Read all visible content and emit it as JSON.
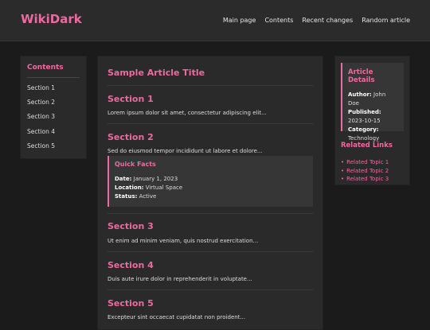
{
  "site": {
    "logo": "WikiDark"
  },
  "nav": [
    "Main page",
    "Contents",
    "Recent changes",
    "Random article"
  ],
  "contents": {
    "heading": "Contents",
    "items": [
      "Section 1",
      "Section 2",
      "Section 3",
      "Section 4",
      "Section 5"
    ]
  },
  "article": {
    "title": "Sample Article Title",
    "sections": [
      {
        "heading": "Section 1",
        "text": "Lorem ipsum dolor sit amet, consectetur adipiscing elit..."
      },
      {
        "heading": "Section 2",
        "text": "Sed do eiusmod tempor incididunt ut labore et dolore..."
      },
      {
        "heading": "Section 3",
        "text": "Ut enim ad minim veniam, quis nostrud exercitation..."
      },
      {
        "heading": "Section 4",
        "text": "Duis aute irure dolor in reprehenderit in voluptate..."
      },
      {
        "heading": "Section 5",
        "text": "Excepteur sint occaecat cupidatat non proident..."
      }
    ],
    "quick_facts": {
      "heading": "Quick Facts",
      "date_label": "Date:",
      "date": "January 1, 2023",
      "location_label": "Location:",
      "location": "Virtual Space",
      "status_label": "Status:",
      "status": "Active"
    }
  },
  "details": {
    "heading": "Article Details",
    "author_label": "Author:",
    "author": "John Doe",
    "published_label": "Published:",
    "published": "2023-10-15",
    "category_label": "Category:",
    "category": "Technology"
  },
  "related": {
    "heading": "Related Links",
    "items": [
      "Related Topic 1",
      "Related Topic 2",
      "Related Topic 3"
    ]
  },
  "colors": {
    "accent": "#ec6aa0",
    "background": "#1b1b1b",
    "panel": "#2a2a2a"
  }
}
